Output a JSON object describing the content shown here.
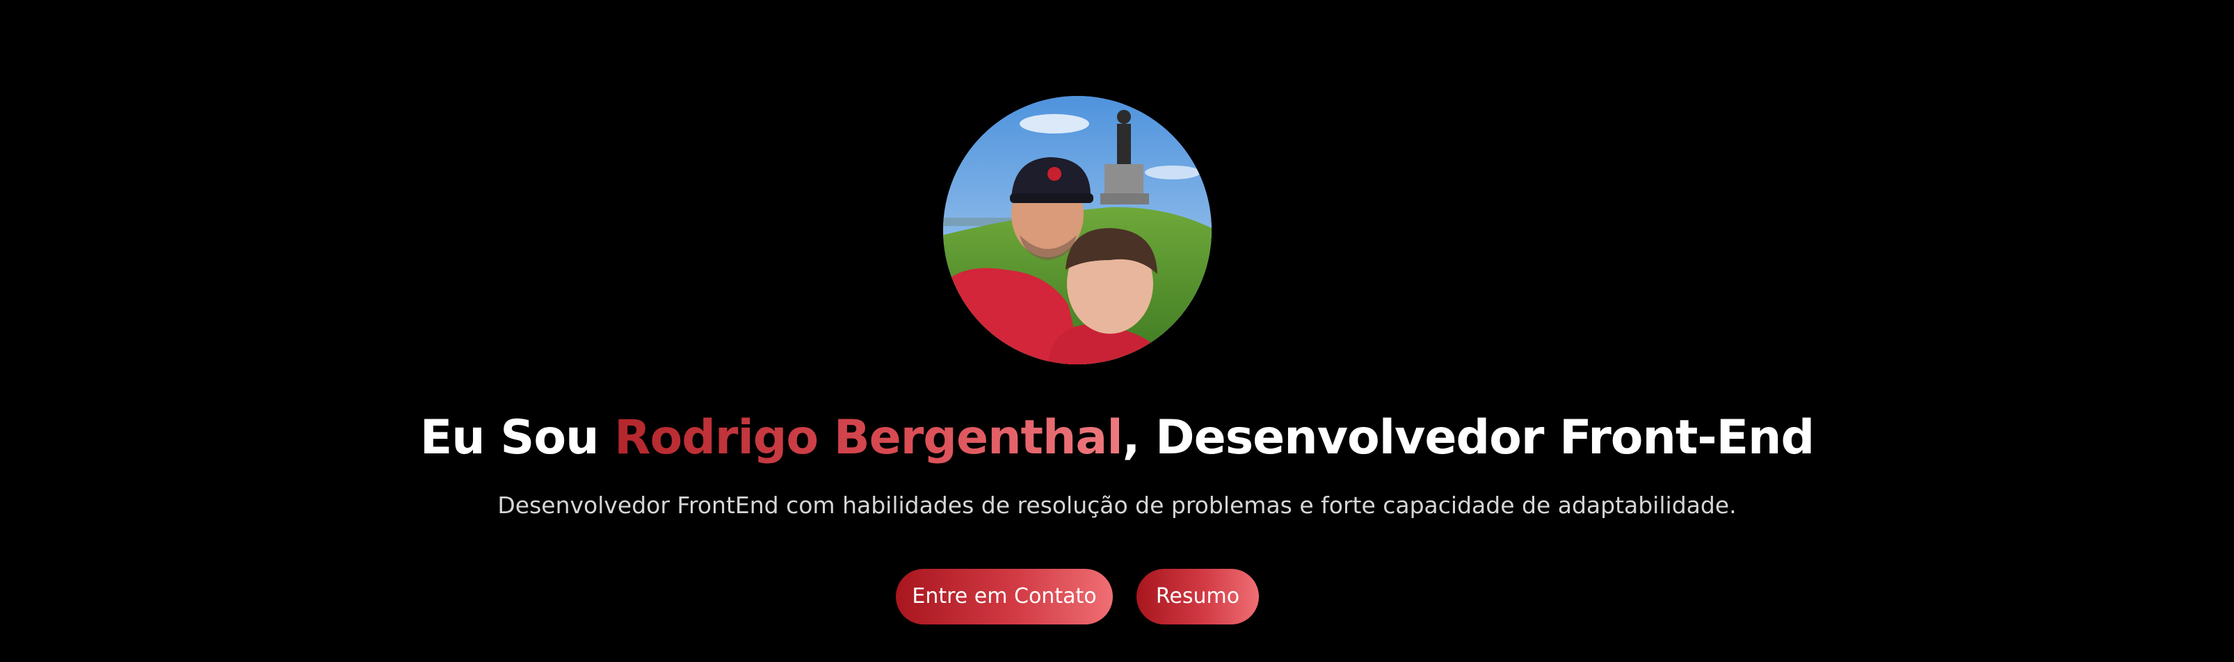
{
  "hero": {
    "headline_prefix": "Eu Sou ",
    "headline_name": "Rodrigo Bergenthal",
    "headline_suffix": ", Desenvolvedor Front-End",
    "subtitle": "Desenvolvedor FrontEnd com habilidades de resolução de problemas e forte capacidade de adaptabilidade.",
    "buttons": {
      "contact_label": "Entre em Contato",
      "resume_label": "Resumo"
    }
  },
  "colors": {
    "background": "#000000",
    "accent_start": "#b3262c",
    "accent_end": "#ee7a7f",
    "text": "#ffffff",
    "subtitle_text": "#d6d6d6"
  }
}
